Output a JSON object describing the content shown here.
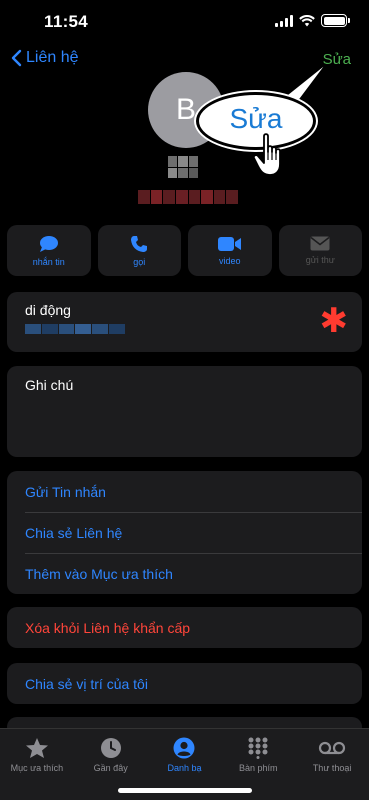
{
  "status": {
    "time": "11:54"
  },
  "nav": {
    "back_label": "Liên hệ",
    "edit_label": "Sửa"
  },
  "contact": {
    "initial": "B"
  },
  "callout": {
    "text": "Sửa"
  },
  "actions": [
    {
      "label": "nhắn tin",
      "icon": "message-icon"
    },
    {
      "label": "gọi",
      "icon": "phone-icon"
    },
    {
      "label": "video",
      "icon": "video-icon"
    },
    {
      "label": "gửi thư",
      "icon": "mail-icon"
    }
  ],
  "phone": {
    "label": "di động"
  },
  "notes": {
    "label": "Ghi chú"
  },
  "list": [
    "Gửi Tin nhắn",
    "Chia sẻ Liên hệ",
    "Thêm vào Mục ưa thích"
  ],
  "emergency": {
    "label": "Xóa khỏi Liên hệ khẩn cấp"
  },
  "location": {
    "label": "Chia sẻ vị trí của tôi"
  },
  "tabs": [
    {
      "label": "Mục ưa thích",
      "icon": "star-icon"
    },
    {
      "label": "Gần đây",
      "icon": "clock-icon"
    },
    {
      "label": "Danh bạ",
      "icon": "contacts-icon"
    },
    {
      "label": "Bàn phím",
      "icon": "keypad-icon"
    },
    {
      "label": "Thư thoại",
      "icon": "voicemail-icon"
    }
  ],
  "colors": {
    "accent": "#2f86ff",
    "destructive": "#ff453a",
    "edit": "#4caf50"
  }
}
